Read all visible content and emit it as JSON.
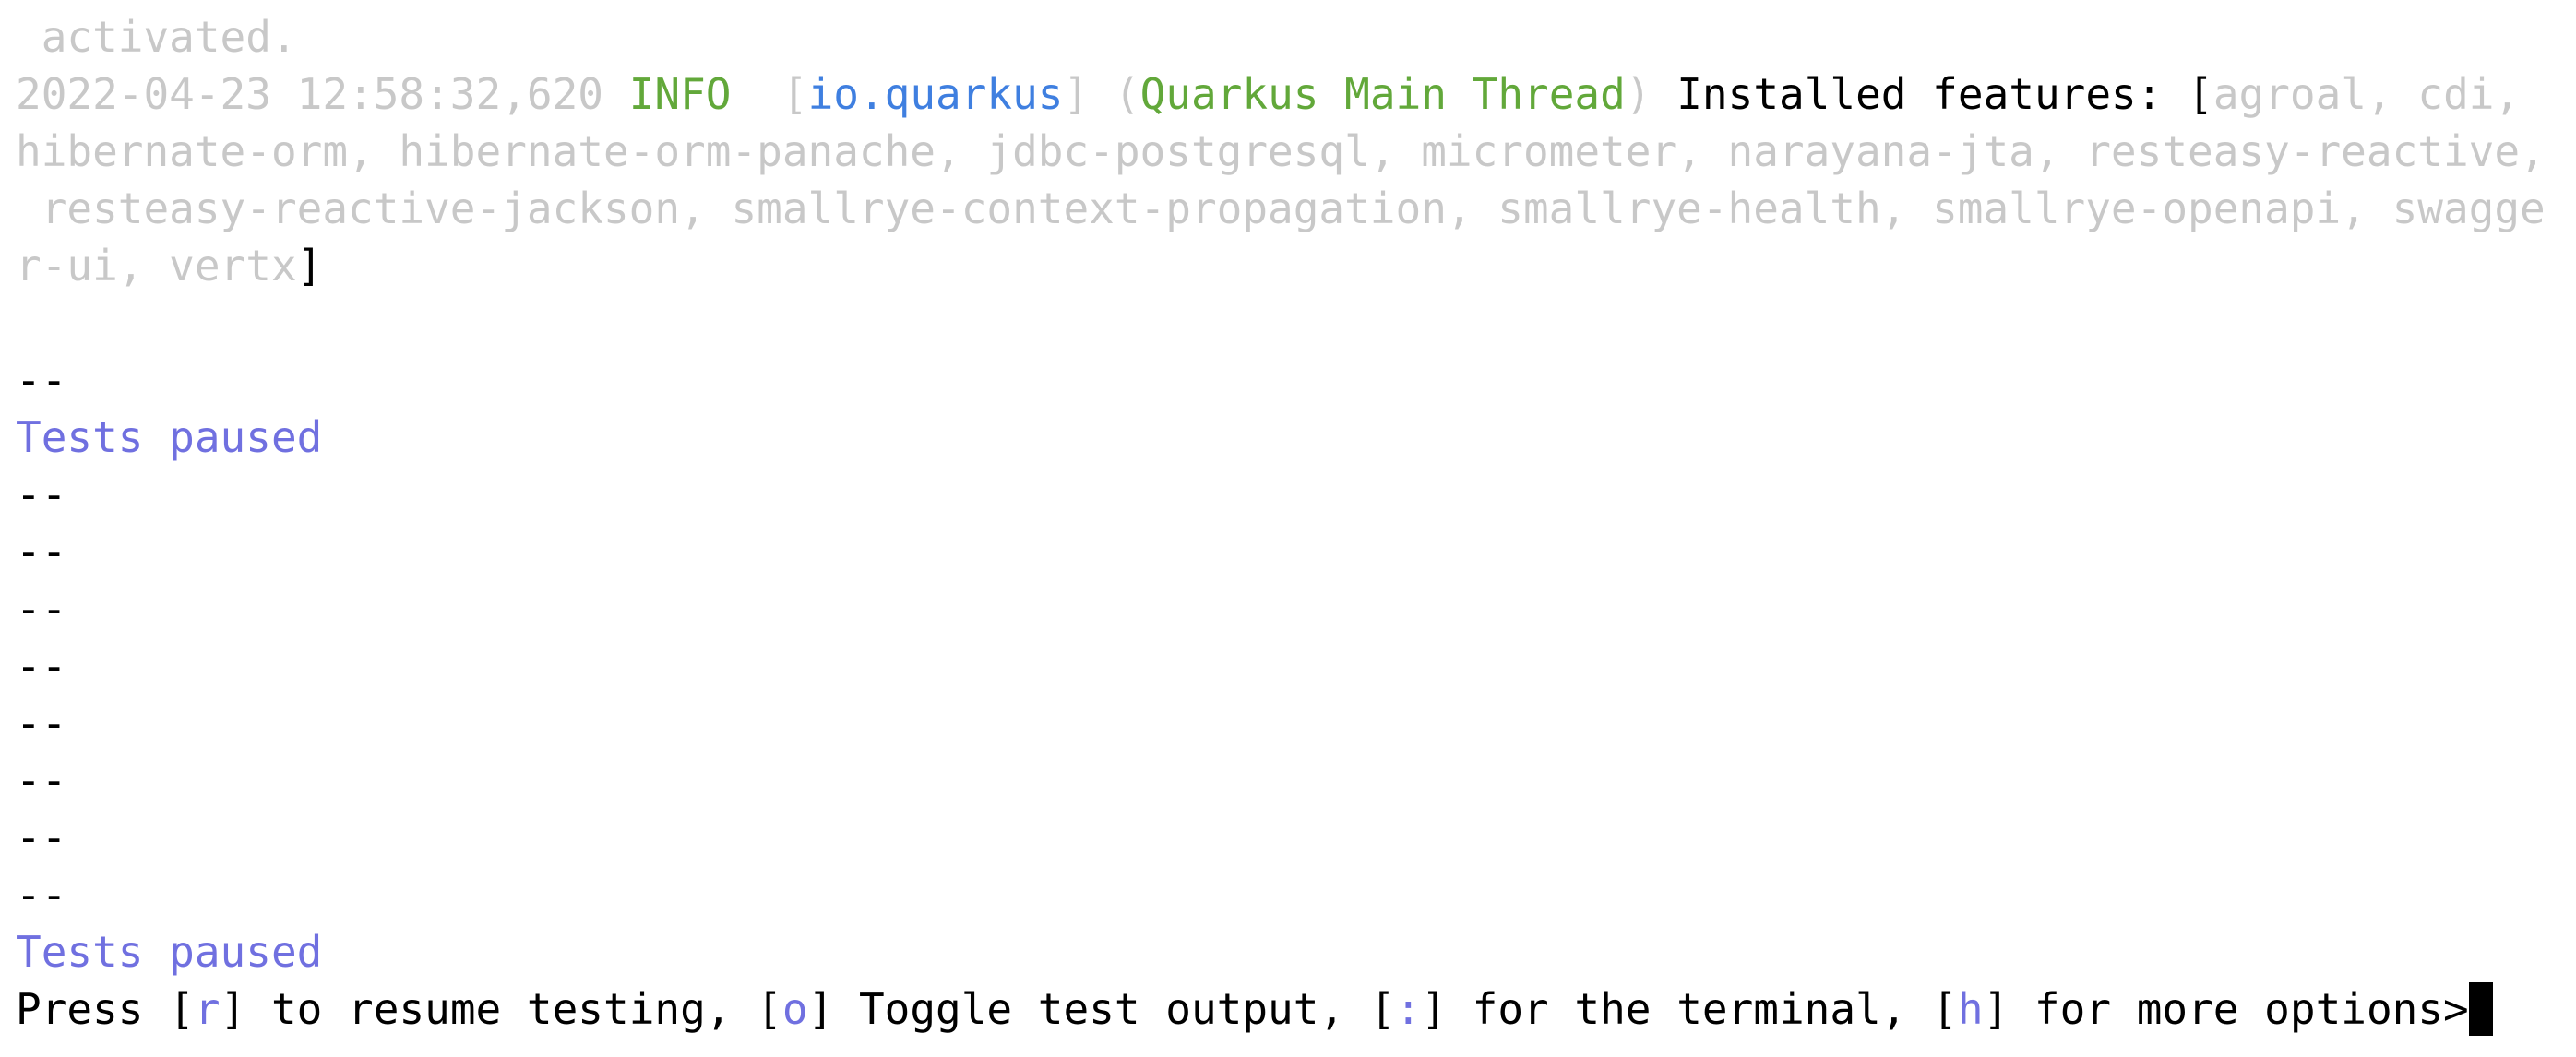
{
  "lines": {
    "l1": " activated.",
    "l2": {
      "timestamp": "2022-04-23 12:58:32,620",
      "level": "INFO",
      "logger_open": "[",
      "logger": "io.quarkus",
      "logger_close": "]",
      "thread_open": "(",
      "thread": "Quarkus Main Thread",
      "thread_close": ")",
      "message": "Installed features: [",
      "features_part1": "agroal, cdi,"
    },
    "l3": "hibernate-orm, hibernate-orm-panache, jdbc-postgresql, micrometer, narayana-jta, resteasy-reactive,",
    "l4": " resteasy-reactive-jackson, smallrye-context-propagation, smallrye-health, smallrye-openapi, swagge",
    "l5": {
      "features_tail": "r-ui, vertx",
      "close_bracket": "]"
    },
    "l6": "",
    "l7": "--",
    "l8": "Tests paused",
    "l9": "--",
    "l10": "--",
    "l11": "--",
    "l12": "--",
    "l13": "--",
    "l14": "--",
    "l15": "--",
    "l16": "--",
    "l17": "Tests paused",
    "l18": {
      "press": "Press [",
      "key_r": "r",
      "resume": "] to resume testing, [",
      "key_o": "o",
      "toggle": "] Toggle test output, [",
      "key_colon": ":",
      "terminal": "] for the terminal, [",
      "key_h": "h",
      "more": "] for more options>"
    }
  },
  "colors": {
    "grey": "#c8c8c8",
    "green": "#62a83a",
    "blue": "#3f7fe0",
    "purple": "#7070e0",
    "text": "#000000",
    "background": "#ffffff"
  }
}
